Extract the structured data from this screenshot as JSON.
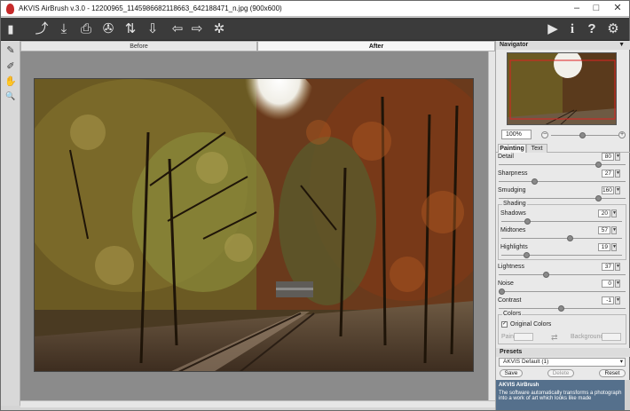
{
  "titlebar": {
    "title": "AKVIS AirBrush v.3.0 - 12200965_1145986682118663_642188471_n.jpg (900x600)",
    "minimize": "–",
    "maximize": "□",
    "close": "✕"
  },
  "toolbar": {
    "icons": [
      "open-icon",
      "save-icon",
      "print-icon",
      "share-icon",
      "batch-icon",
      "export-icon",
      "undo-icon",
      "redo-icon",
      "settings-gear-icon",
      "run-icon",
      "info-icon",
      "help-icon",
      "preferences-icon"
    ],
    "glyphs": {
      "open": "⤴",
      "save": "⤓",
      "print": "⎙",
      "share": "✇",
      "batch": "⇅",
      "export": "⇩",
      "undo": "⇦",
      "redo": "⇨",
      "gear": "✲",
      "run": "▶",
      "info": "i",
      "help": "?",
      "prefs": "⚙"
    }
  },
  "lefttools": {
    "brush": "✎",
    "eraser": "✐",
    "hand": "✋",
    "zoom": "🔍"
  },
  "view_tabs": {
    "before": "Before",
    "after": "After"
  },
  "navigator": {
    "title": "Navigator",
    "zoom": "100%",
    "collapse": "▼",
    "minus": "−",
    "plus": "+"
  },
  "panel_tabs": {
    "painting": "Painting",
    "text": "Text"
  },
  "params": {
    "detail": {
      "label": "Detail",
      "value": "80",
      "max": 100
    },
    "sharpness": {
      "label": "Sharpness",
      "value": "27",
      "max": 100
    },
    "smudging": {
      "label": "Smudging",
      "value": "160",
      "max": 200
    },
    "shading_title": "Shading",
    "shadows": {
      "label": "Shadows",
      "value": "20",
      "max": 100
    },
    "midtones": {
      "label": "Midtones",
      "value": "57",
      "max": 100
    },
    "highlights": {
      "label": "Highlights",
      "value": "19",
      "max": 100
    },
    "lightness": {
      "label": "Lightness",
      "value": "37",
      "max": 100
    },
    "noise": {
      "label": "Noise",
      "value": "0",
      "max": 100
    },
    "contrast": {
      "label": "Contrast",
      "value": "-1",
      "min": -50,
      "max": 50
    }
  },
  "colors": {
    "title": "Colors",
    "original_label": "Original Colors",
    "original_checked": "✓",
    "paint_label": "Paint",
    "background_label": "Background",
    "swap_glyph": "⇄"
  },
  "presets": {
    "title": "Presets",
    "selected": "AKVIS Default (1)",
    "save": "Save",
    "delete": "Delete",
    "reset": "Reset"
  },
  "help": {
    "title": "AKVIS AirBrush",
    "text": "The software automatically transforms a photograph into a work of art which looks like made"
  },
  "spin_up": "▲",
  "spin_down": "▼",
  "arrow_down": "▾",
  "accent": {
    "help_bg": "#55708c",
    "logo": "#c62a2a",
    "toolbar": "#3b3b3b"
  }
}
